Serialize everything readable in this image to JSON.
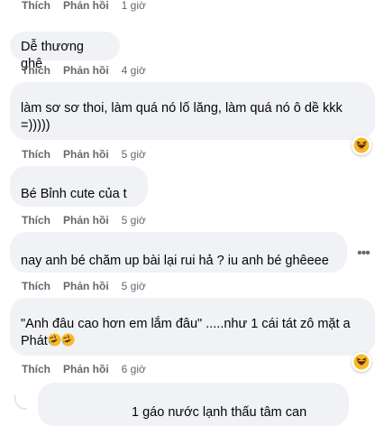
{
  "comments": [
    {
      "text": "",
      "like": "Thích",
      "reply": "Phản hồi",
      "time": "1 giờ"
    },
    {
      "text": "Dễ thương ghê",
      "like": "Thích",
      "reply": "Phản hồi",
      "time": "4 giờ"
    },
    {
      "text": "làm sơ sơ thoi, làm quá nó lố lăng, làm quá nó ô dề kkk =)))))",
      "like": "Thích",
      "reply": "Phản hồi",
      "time": "5 giờ",
      "reaction": "haha-emoji-icon"
    },
    {
      "text": "Bé Bỉnh cute của t",
      "like": "Thích",
      "reply": "Phản hồi",
      "time": "5 giờ"
    },
    {
      "text": "nay anh bé chăm up bài lại rui hả ? iu anh bé ghêeee",
      "like": "Thích",
      "reply": "Phản hồi",
      "time": "5 giờ"
    },
    {
      "text": "\"Anh đâu cao hơn em lắm đâu\" .....như 1 cái tát zô mặt a Phát",
      "like": "Thích",
      "reply": "Phản hồi",
      "time": "6 giờ",
      "reaction": "haha-emoji-icon",
      "inline_emoji": "rofl-emoji-icon"
    },
    {
      "text": "1 gáo nước lạnh thấu tâm can"
    }
  ],
  "colors": {
    "bubble": "#f0f2f5",
    "meta": "#65676b",
    "text": "#050505",
    "emoji": "#f7b928"
  }
}
